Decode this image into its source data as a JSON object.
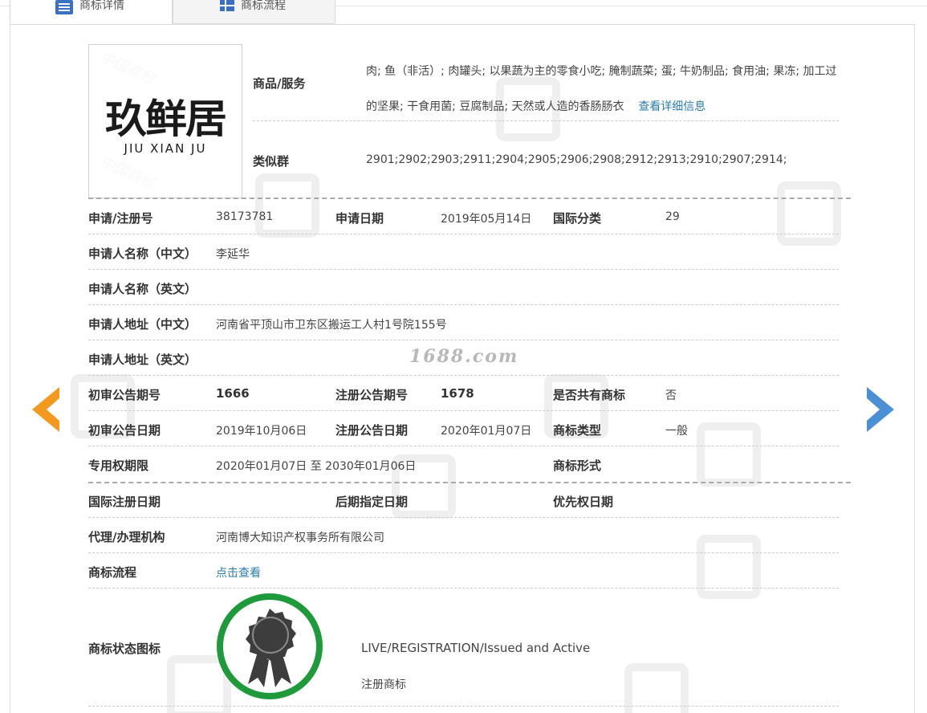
{
  "tabs": [
    {
      "label": "商标详情"
    },
    {
      "label": "商标流程"
    }
  ],
  "logo": {
    "cn_text": "玖鲜居",
    "en_text": "JIU XIAN JU"
  },
  "goods": {
    "label": "商品/服务",
    "text": "肉; 鱼（非活）; 肉罐头; 以果蔬为主的零食小吃; 腌制蔬菜; 蛋; 牛奶制品; 食用油; 果冻; 加工过的坚果; 干食用菌; 豆腐制品; 天然或人造的香肠肠衣",
    "more_link": "查看详细信息"
  },
  "similar_group": {
    "label": "类似群",
    "value": "2901;2902;2903;2911;2904;2905;2906;2908;2912;2913;2910;2907;2914;"
  },
  "fields": {
    "reg_no_label": "申请/注册号",
    "reg_no": "38173781",
    "apply_date_label": "申请日期",
    "apply_date": "2019年05月14日",
    "intl_class_label": "国际分类",
    "intl_class": "29",
    "applicant_cn_label": "申请人名称（中文）",
    "applicant_cn": "李延华",
    "applicant_en_label": "申请人名称（英文）",
    "applicant_en": "",
    "address_cn_label": "申请人地址（中文）",
    "address_cn": "河南省平顶山市卫东区搬运工人村1号院155号",
    "address_en_label": "申请人地址（英文）",
    "address_en": "",
    "prelim_issue_label": "初审公告期号",
    "prelim_issue": "1666",
    "reg_issue_label": "注册公告期号",
    "reg_issue": "1678",
    "shared_label": "是否共有商标",
    "shared": "否",
    "prelim_date_label": "初审公告日期",
    "prelim_date": "2019年10月06日",
    "reg_date_label": "注册公告日期",
    "reg_date": "2020年01月07日",
    "tm_type_label": "商标类型",
    "tm_type": "一般",
    "exclusive_label": "专用权期限",
    "exclusive": "2020年01月07日 至 2030年01月06日",
    "tm_form_label": "商标形式",
    "tm_form": "",
    "intl_reg_date_label": "国际注册日期",
    "intl_reg_date": "",
    "later_date_label": "后期指定日期",
    "later_date": "",
    "priority_date_label": "优先权日期",
    "priority_date": "",
    "agent_label": "代理/办理机构",
    "agent": "河南博大知识产权事务所有限公司",
    "flow_label": "商标流程",
    "flow_link": "点击查看",
    "status_icon_label": "商标状态图标",
    "status_en": "LIVE/REGISTRATION/Issued and Active",
    "status_cn": "注册商标"
  },
  "watermark_text": "1688.com",
  "colors": {
    "accent_link": "#2a7cb0",
    "prev_arrow": "#f39a1e",
    "next_arrow": "#4b90d6",
    "seal_ring": "#1e9a3a",
    "seal_body": "#3d3d3d"
  }
}
